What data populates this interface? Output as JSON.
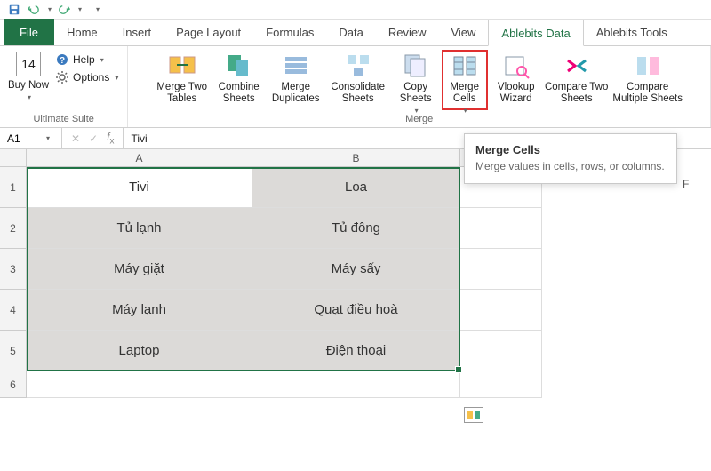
{
  "qat": {
    "save": "save-icon",
    "undo": "undo-icon",
    "redo": "redo-icon"
  },
  "tabs": {
    "file": "File",
    "items": [
      "Home",
      "Insert",
      "Page Layout",
      "Formulas",
      "Data",
      "Review",
      "View",
      "Ablebits Data",
      "Ablebits Tools"
    ],
    "active": "Ablebits Data"
  },
  "ribbon": {
    "ultimate": {
      "day_number": "14",
      "buy_now": "Buy Now",
      "help": "Help",
      "options": "Options",
      "group_label": "Ultimate Suite"
    },
    "merge_group": {
      "merge_two_tables": "Merge Two Tables",
      "combine_sheets": "Combine Sheets",
      "merge_duplicates": "Merge Duplicates",
      "consolidate_sheets": "Consolidate Sheets",
      "copy_sheets": "Copy Sheets",
      "merge_cells": "Merge Cells",
      "vlookup_wizard": "Vlookup Wizard",
      "compare_two_sheets": "Compare Two Sheets",
      "compare_multiple_sheets": "Compare Multiple Sheets",
      "group_label": "Merge"
    }
  },
  "tooltip": {
    "title": "Merge Cells",
    "body": "Merge values in cells, rows, or columns."
  },
  "formula_bar": {
    "name_box": "A1",
    "fx_value": "Tivi"
  },
  "columns": [
    "A",
    "B"
  ],
  "extra_column_label": "F",
  "rows": [
    "1",
    "2",
    "3",
    "4",
    "5",
    "6"
  ],
  "data": {
    "r1": {
      "a": "Tivi",
      "b": "Loa"
    },
    "r2": {
      "a": "Tủ lạnh",
      "b": "Tủ đông"
    },
    "r3": {
      "a": "Máy giặt",
      "b": "Máy sấy"
    },
    "r4": {
      "a": "Máy lạnh",
      "b": "Quạt điều hoà"
    },
    "r5": {
      "a": "Laptop",
      "b": "Điện thoại"
    }
  },
  "colors": {
    "accent": "#217346",
    "highlight": "#e03030"
  }
}
